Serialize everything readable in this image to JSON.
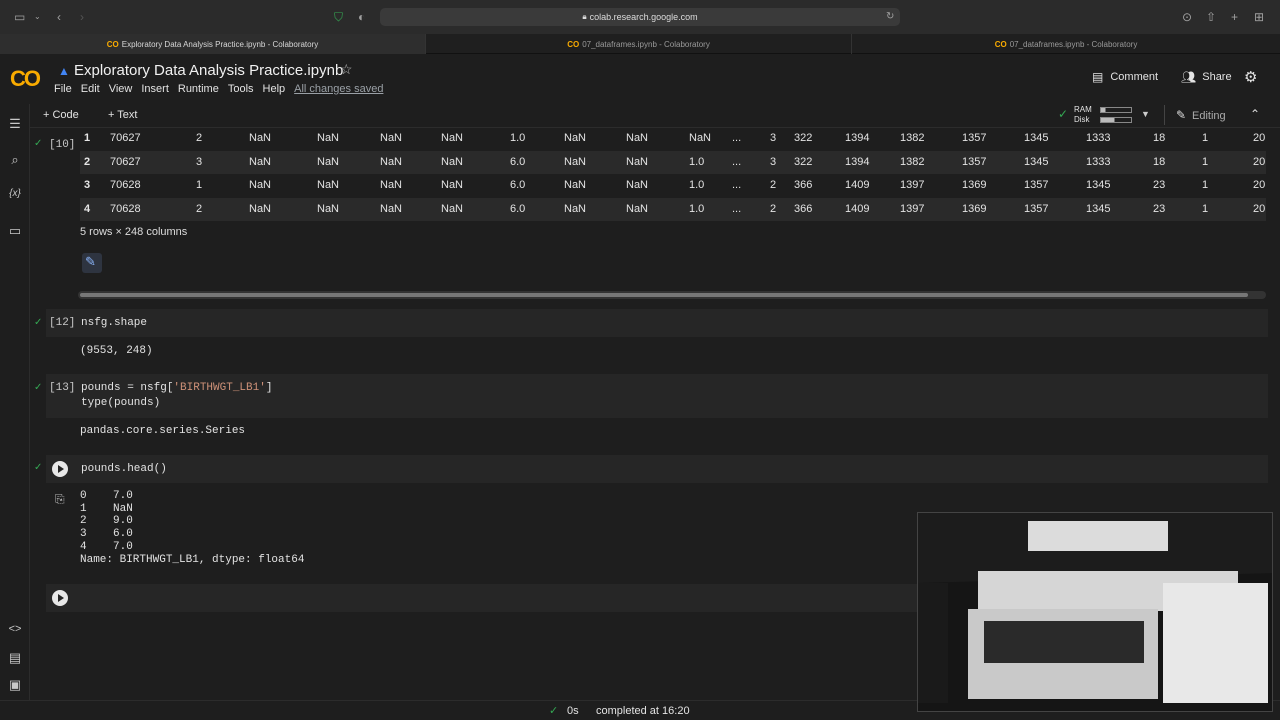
{
  "browser": {
    "url": "colab.research.google.com",
    "tabs": [
      {
        "label": "Exploratory Data Analysis Practice.ipynb - Colaboratory",
        "active": true
      },
      {
        "label": "07_dataframes.ipynb - Colaboratory",
        "active": false
      },
      {
        "label": "07_dataframes.ipynb - Colaboratory",
        "active": false
      }
    ]
  },
  "header": {
    "logo": "CO",
    "notebook_title": "Exploratory Data Analysis Practice.ipynb",
    "comment_label": "Comment",
    "share_label": "Share",
    "menu": [
      "File",
      "Edit",
      "View",
      "Insert",
      "Runtime",
      "Tools",
      "Help"
    ],
    "saved_status": "All changes saved"
  },
  "toolbar": {
    "add_code": "+ Code",
    "add_text": "+ Text",
    "ram_label": "RAM",
    "disk_label": "Disk",
    "editing_label": "Editing"
  },
  "cells": {
    "c10": {
      "exec_count": "[10]",
      "table_rows": [
        [
          "1",
          "70627",
          "2",
          "NaN",
          "NaN",
          "NaN",
          "NaN",
          "1.0",
          "NaN",
          "NaN",
          "NaN",
          "...",
          "3",
          "322",
          "1394",
          "1382",
          "1357",
          "1345",
          "1333",
          "18",
          "1",
          "20"
        ],
        [
          "2",
          "70627",
          "3",
          "NaN",
          "NaN",
          "NaN",
          "NaN",
          "6.0",
          "NaN",
          "NaN",
          "1.0",
          "...",
          "3",
          "322",
          "1394",
          "1382",
          "1357",
          "1345",
          "1333",
          "18",
          "1",
          "20"
        ],
        [
          "3",
          "70628",
          "1",
          "NaN",
          "NaN",
          "NaN",
          "NaN",
          "6.0",
          "NaN",
          "NaN",
          "1.0",
          "...",
          "2",
          "366",
          "1409",
          "1397",
          "1369",
          "1357",
          "1345",
          "23",
          "1",
          "20"
        ],
        [
          "4",
          "70628",
          "2",
          "NaN",
          "NaN",
          "NaN",
          "NaN",
          "6.0",
          "NaN",
          "NaN",
          "1.0",
          "...",
          "2",
          "366",
          "1409",
          "1397",
          "1369",
          "1357",
          "1345",
          "23",
          "1",
          "20"
        ]
      ],
      "shape_caption": "5 rows × 248 columns"
    },
    "c12": {
      "exec_count": "[12]",
      "code": "nsfg.shape",
      "output": "(9553, 248)"
    },
    "c13": {
      "exec_count": "[13]",
      "code_line1_prefix": "pounds = nsfg[",
      "code_line1_string": "'BIRTHWGT_LB1'",
      "code_line1_suffix": "]",
      "code_line2": "type(pounds)",
      "output": "pandas.core.series.Series"
    },
    "c14": {
      "code": "pounds.head()",
      "output_lines": [
        "0    7.0",
        "1    NaN",
        "2    9.0",
        "3    6.0",
        "4    7.0",
        "Name: BIRTHWGT_LB1, dtype: float64"
      ]
    }
  },
  "status": {
    "duration": "0s",
    "completed": "completed at 16:20"
  },
  "colors": {
    "accent": "#f9ab00",
    "success": "#34a853"
  }
}
